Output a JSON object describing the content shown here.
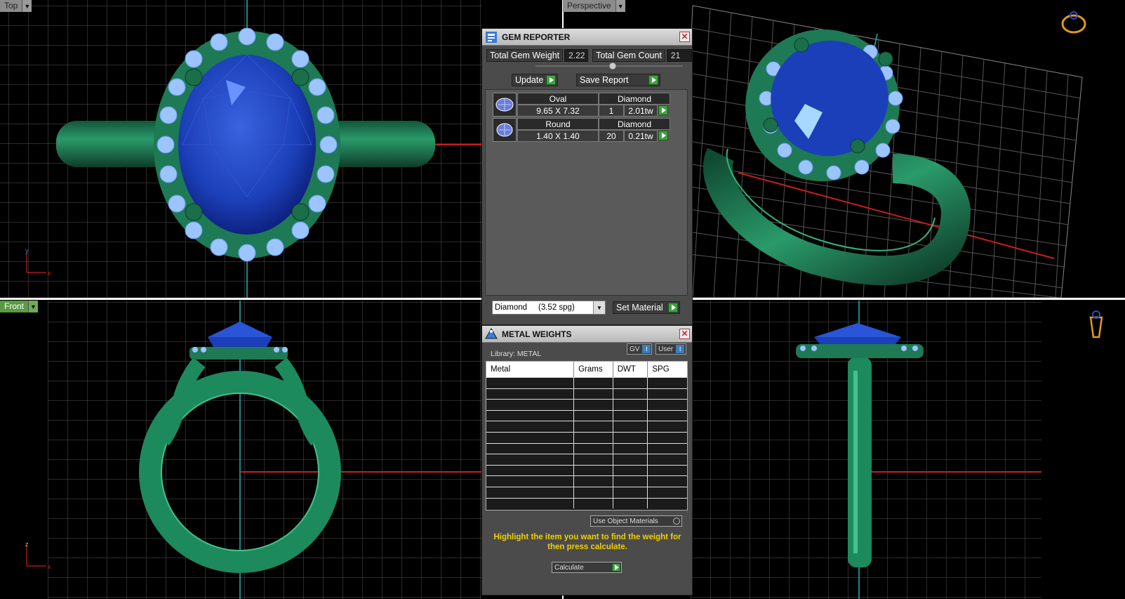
{
  "viewports": {
    "top": {
      "label": "Top"
    },
    "perspective": {
      "label": "Perspective"
    },
    "front": {
      "label": "Front"
    },
    "right": {
      "label": ""
    }
  },
  "axes": {
    "top_y": "y",
    "top_x": "x",
    "front_z": "z",
    "front_x": "x"
  },
  "gem_reporter": {
    "title": "GEM REPORTER",
    "total_weight_label": "Total Gem Weight",
    "total_weight": "2.22",
    "total_count_label": "Total Gem Count",
    "total_count": "21",
    "update_label": "Update",
    "save_report_label": "Save Report",
    "gems": [
      {
        "shape": "Oval",
        "material": "Diamond",
        "size": "9.65 X 7.32",
        "count": "1",
        "weight": "2.01tw"
      },
      {
        "shape": "Round",
        "material": "Diamond",
        "size": "1.40 X 1.40",
        "count": "20",
        "weight": "0.21tw"
      }
    ],
    "material_select": "Diamond     (3.52 spg)",
    "set_material_label": "Set Material"
  },
  "metal_weights": {
    "title": "METAL WEIGHTS",
    "library": "Library: METAL",
    "gv_label": "GV",
    "user_label": "User",
    "columns": [
      "Metal",
      "Grams",
      "DWT",
      "SPG"
    ],
    "use_object_materials": "Use Object Materials",
    "hint": "Highlight the item you want to find the weight for then press calculate.",
    "calculate_label": "Calculate"
  },
  "colors": {
    "metal": "#1f7a52",
    "stone": "#1b3fb8",
    "accent": "#3fa33f",
    "hint": "#f0d000"
  }
}
